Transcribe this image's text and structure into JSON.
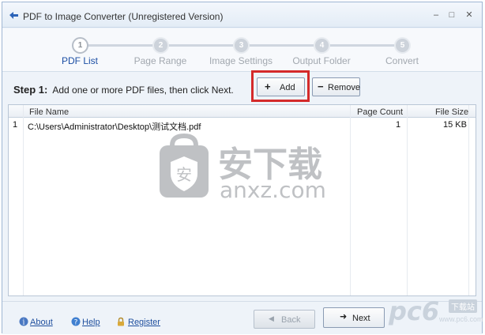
{
  "window": {
    "title": "PDF to Image Converter (Unregistered Version)",
    "controls": {
      "minimize": "–",
      "maximize": "□",
      "close": "✕"
    }
  },
  "wizard": {
    "steps": [
      {
        "number": "1",
        "label": "PDF List",
        "active": true
      },
      {
        "number": "2",
        "label": "Page Range",
        "active": false
      },
      {
        "number": "3",
        "label": "Image Settings",
        "active": false
      },
      {
        "number": "4",
        "label": "Output Folder",
        "active": false
      },
      {
        "number": "5",
        "label": "Convert",
        "active": false
      }
    ]
  },
  "toolbar": {
    "step_title": "Step 1:",
    "step_instruction": "Add one or more PDF files, then click Next.",
    "add_label": "Add",
    "add_glyph": "+",
    "remove_label": "Remove",
    "remove_glyph": "−"
  },
  "table": {
    "columns": [
      "File Name",
      "Page Count",
      "File Size"
    ],
    "rows": [
      {
        "index": "1",
        "file_name": "C:\\Users\\Administrator\\Desktop\\测试文档.pdf",
        "page_count": "1",
        "file_size": "15 KB"
      }
    ]
  },
  "watermark": {
    "cn": "安下载",
    "en": "anxz.com"
  },
  "footer": {
    "about": "About",
    "help": "Help",
    "register": "Register",
    "back": "Back",
    "back_glyph": "◀",
    "next": "Next",
    "next_glyph": "➜"
  },
  "corner_logo": {
    "text": "pc6",
    "tag": "下载站",
    "url": "www.pc6.com"
  },
  "colors": {
    "accent": "#1c4fa4",
    "highlight": "#d42a2a",
    "link": "#1f4f9e"
  }
}
